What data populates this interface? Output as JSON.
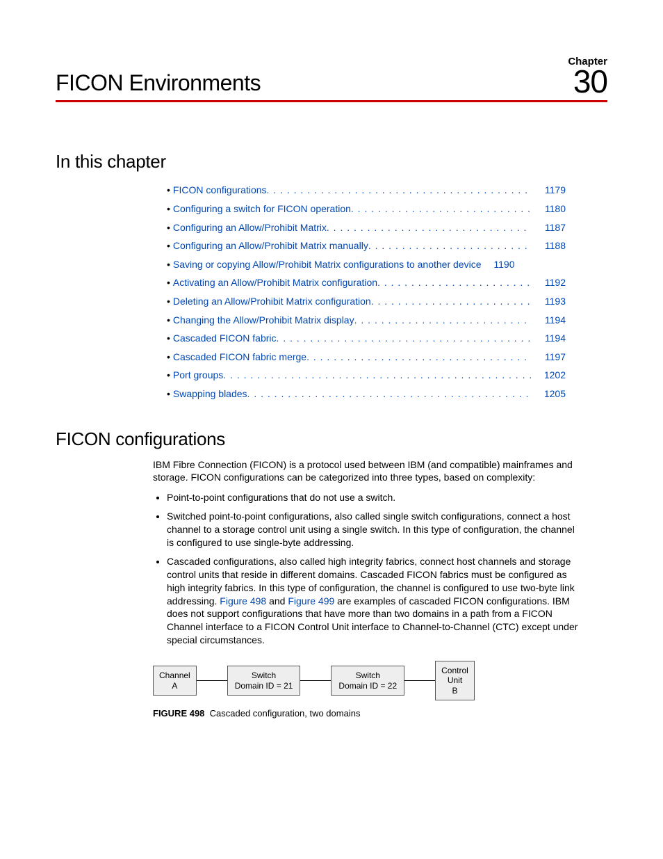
{
  "header": {
    "chapter_label": "Chapter",
    "chapter_number": "30",
    "chapter_title": "FICON Environments"
  },
  "sections": {
    "in_this_chapter": "In this chapter",
    "ficon_configurations": "FICON configurations"
  },
  "toc": [
    {
      "label": "FICON configurations",
      "page": "1179"
    },
    {
      "label": "Configuring a switch for FICON operation",
      "page": "1180"
    },
    {
      "label": "Configuring an Allow/Prohibit Matrix",
      "page": "1187"
    },
    {
      "label": "Configuring an Allow/Prohibit Matrix manually",
      "page": "1188"
    },
    {
      "label": "Saving or copying Allow/Prohibit Matrix configurations to another device",
      "page": "1190"
    },
    {
      "label": "Activating an Allow/Prohibit Matrix configuration",
      "page": "1192"
    },
    {
      "label": "Deleting an Allow/Prohibit Matrix configuration",
      "page": "1193"
    },
    {
      "label": "Changing the Allow/Prohibit Matrix display",
      "page": "1194"
    },
    {
      "label": "Cascaded FICON fabric",
      "page": "1194"
    },
    {
      "label": "Cascaded FICON fabric merge",
      "page": "1197"
    },
    {
      "label": "Port groups",
      "page": "1202"
    },
    {
      "label": "Swapping blades",
      "page": "1205"
    }
  ],
  "body": {
    "intro": "IBM Fibre Connection (FICON) is a protocol used between IBM (and compatible) mainframes and storage. FICON configurations can be categorized into three types, based on complexity:",
    "bullets": {
      "b1": "Point-to-point configurations that do not use a switch.",
      "b2": "Switched point-to-point configurations, also called single switch configurations, connect a host channel to a storage control unit using a single switch. In this type of configuration, the channel is configured to use single-byte addressing.",
      "b3_pre": "Cascaded configurations, also called high integrity fabrics, connect host channels and storage control units that reside in different domains. Cascaded FICON fabrics must be configured as high integrity fabrics. In this type of configuration, the channel is configured to use two-byte link addressing. ",
      "b3_fig498": "Figure 498",
      "b3_and": " and ",
      "b3_fig499": "Figure 499",
      "b3_post": " are examples of cascaded FICON configurations. IBM does not support configurations that have more than two domains in a path from a FICON Channel interface to a FICON Control Unit interface to Channel-to-Channel (CTC) except under special circumstances."
    }
  },
  "figure498": {
    "nodes": {
      "channel_a_l1": "Channel",
      "channel_a_l2": "A",
      "switch21_l1": "Switch",
      "switch21_l2": "Domain ID = 21",
      "switch22_l1": "Switch",
      "switch22_l2": "Domain ID = 22",
      "control_b_l1": "Control",
      "control_b_l2": "Unit",
      "control_b_l3": "B"
    },
    "caption_label": "FIGURE 498",
    "caption_text": "Cascaded configuration, two domains"
  }
}
